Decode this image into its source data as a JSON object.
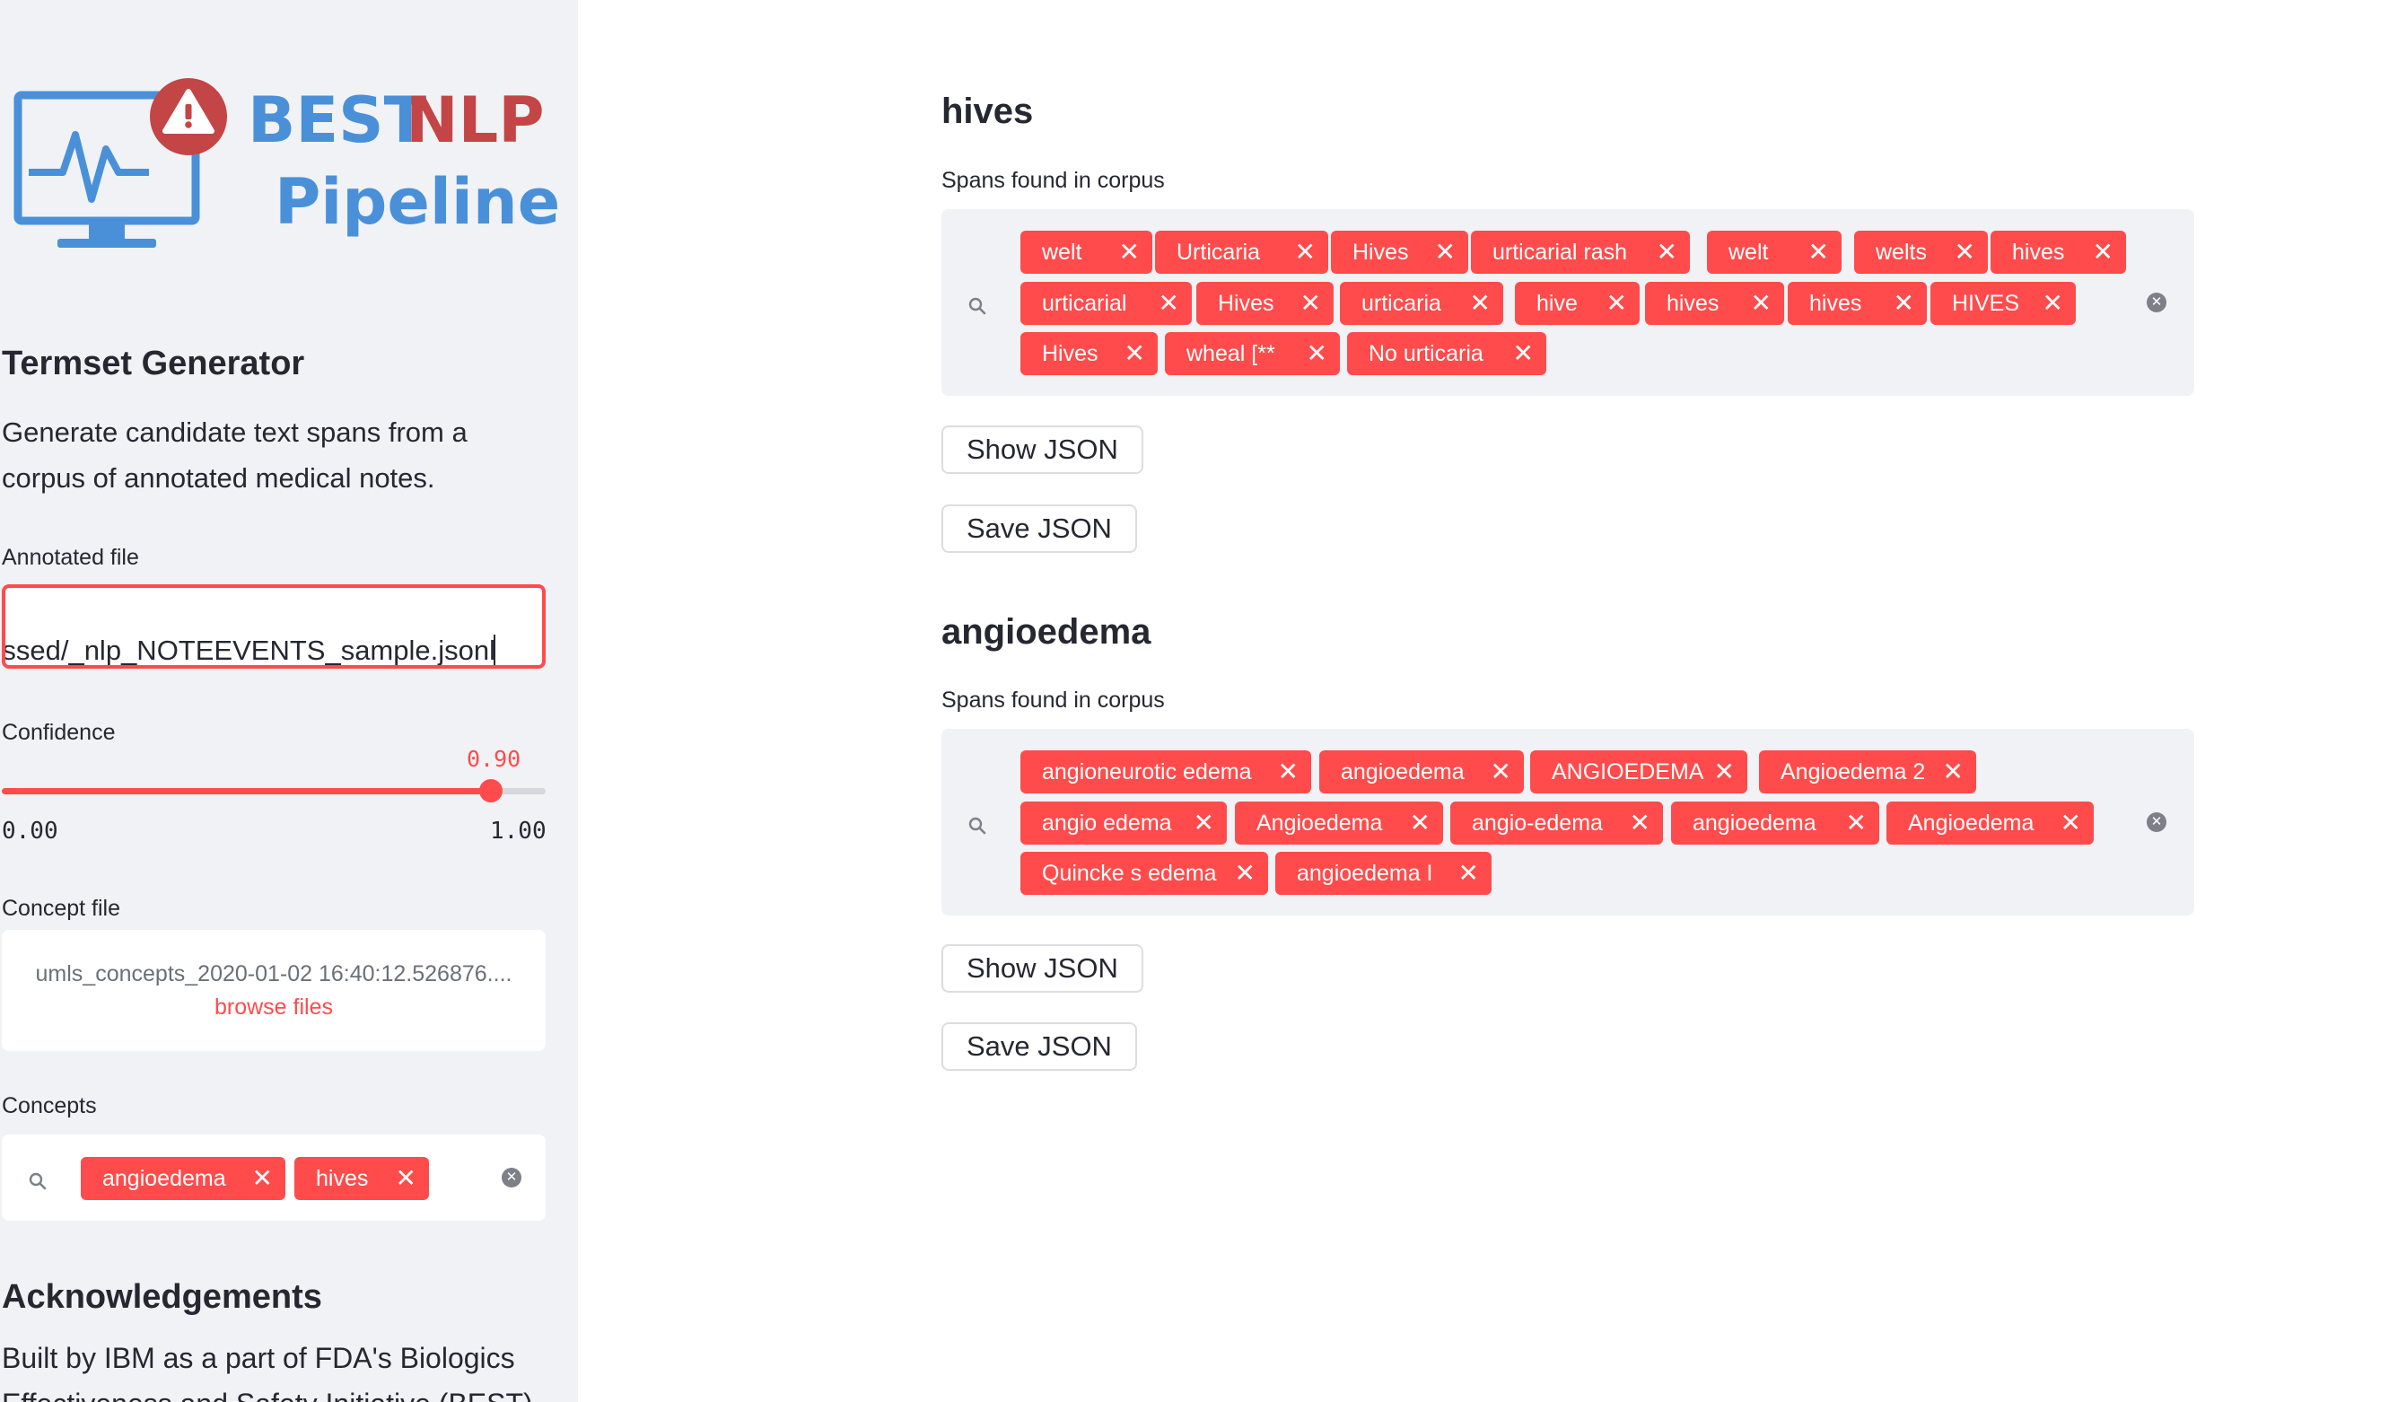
{
  "logo": {
    "word1": "BEST",
    "word2": "NLP",
    "word3": "Pipeline",
    "icon": "monitor-heartbeat-warning-icon"
  },
  "sidebar": {
    "title": "Termset Generator",
    "description": "Generate candidate text spans from a corpus of annotated medical notes.",
    "annotated_file": {
      "label": "Annotated file",
      "value": "ѕsed/_nlp_NOTEEVENTS_sample.jsonl"
    },
    "confidence": {
      "label": "Confidence",
      "value": "0.90",
      "min": "0.00",
      "max": "1.00",
      "fraction": 0.9
    },
    "concept_file": {
      "label": "Concept file",
      "filename": "umls_concepts_2020-01-02 16:40:12.526876....",
      "browse": "browse files"
    },
    "concepts": {
      "label": "Concepts",
      "tags": [
        "angioedema",
        "hives"
      ]
    },
    "acknowledgements": {
      "title": "Acknowledgements",
      "text": "Built by IBM as a part of FDA's Biologics Effectiveness and Safety Initiative (BEST)"
    }
  },
  "sections": [
    {
      "title": "hives",
      "spans_label": "Spans found in corpus",
      "spans": [
        "welt",
        "Urticaria",
        "Hives",
        "urticarial rash",
        "welt",
        "welts",
        "hives",
        "urticarial",
        "Hives",
        "urticaria",
        "hive",
        "hives",
        "hives",
        "HIVES",
        "Hives",
        "wheal [**",
        "No urticaria"
      ],
      "show_json": "Show JSON",
      "save_json": "Save JSON"
    },
    {
      "title": "angioedema",
      "spans_label": "Spans found in corpus",
      "spans": [
        "angioneurotic edema",
        "angioedema",
        "ANGIOEDEMA",
        "Angioedema 2",
        "angio edema",
        "Angioedema",
        "angio-edema",
        "angioedema",
        "Angioedema",
        "Quincke s edema",
        "angioedema I"
      ],
      "show_json": "Show JSON",
      "save_json": "Save JSON"
    }
  ],
  "colors": {
    "accent": "#ff4b4b",
    "sidebar_bg": "#f0f2f6",
    "logo_blue": "#4a90d9",
    "logo_red": "#c44545",
    "text": "#262730"
  }
}
